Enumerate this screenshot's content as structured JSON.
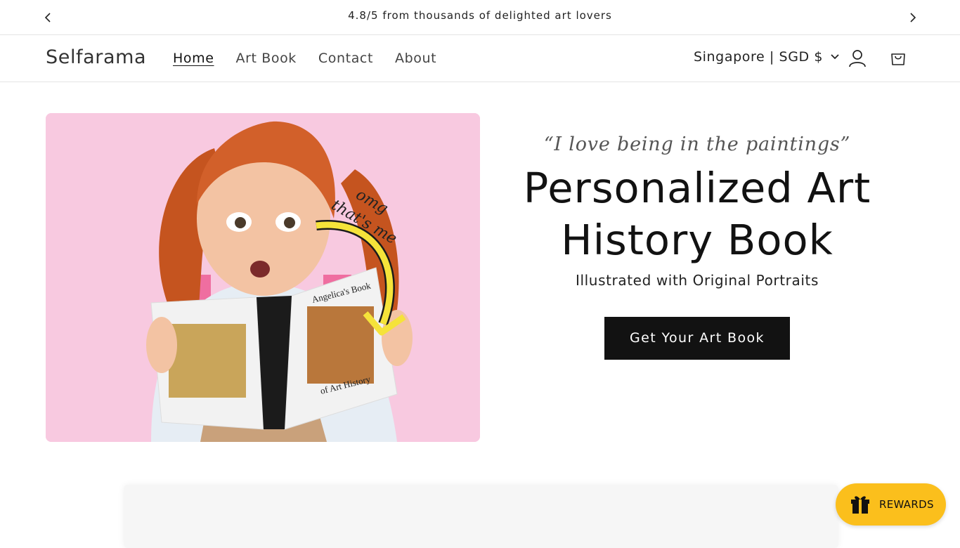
{
  "announcement": {
    "text": "4.8/5 from thousands of delighted art lovers",
    "prev_icon": "chevron-left-icon",
    "next_icon": "chevron-right-icon"
  },
  "header": {
    "logo": "Selfarama",
    "nav": [
      {
        "label": "Home",
        "active": true
      },
      {
        "label": "Art Book",
        "active": false
      },
      {
        "label": "Contact",
        "active": false
      },
      {
        "label": "About",
        "active": false
      }
    ],
    "locale": "Singapore | SGD $",
    "icons": [
      "chevron-down-icon",
      "user-icon",
      "cart-icon"
    ]
  },
  "hero": {
    "image_background": "#f8c9e0",
    "image_text": {
      "scribble": "omg that's me",
      "book_title_top": "Angelica's Book",
      "book_title_bottom": "of Art History"
    },
    "quote": "“I love being in the paintings”",
    "title_line1": "Personalized Art",
    "title_line2": "History Book",
    "subtitle": "Illustrated with Original Portraits",
    "cta": "Get Your Art Book"
  },
  "rewards": {
    "label": "REWARDS",
    "icon": "gift-icon",
    "color": "#fbbf1c"
  }
}
